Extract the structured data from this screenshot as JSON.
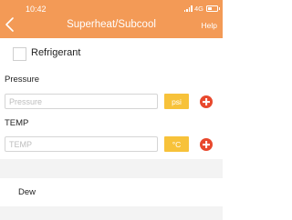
{
  "status_bar": {
    "time": "10:42",
    "network": "4G"
  },
  "header": {
    "title": "Superheat/Subcool",
    "help_label": "Help",
    "back_icon": "chevron-left-icon",
    "background_color": "#f39a56"
  },
  "refrigerant": {
    "label": "Refrigerant"
  },
  "pressure": {
    "label": "Pressure",
    "placeholder": "Pressure",
    "value": "",
    "unit": "psi"
  },
  "temp": {
    "label": "TEMP",
    "placeholder": "TEMP",
    "value": "",
    "unit": "°C"
  },
  "dew": {
    "label": "Dew"
  },
  "colors": {
    "unit_button": "#f7c23a",
    "add_button": "#e8482d",
    "band": "#f3f3f3"
  }
}
